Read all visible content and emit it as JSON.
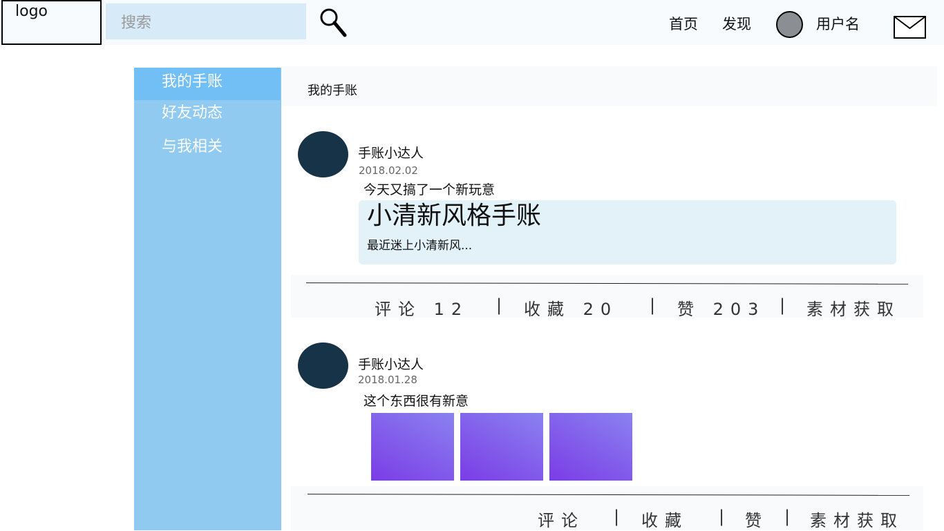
{
  "header": {
    "logo": "logo",
    "search_placeholder": "搜索",
    "nav": [
      "首页",
      "发现"
    ],
    "username": "用户名"
  },
  "sidebar": {
    "items": [
      {
        "label": "我的手账",
        "active": true
      },
      {
        "label": "好友动态",
        "active": false
      },
      {
        "label": "与我相关",
        "active": false
      }
    ]
  },
  "main": {
    "title": "我的手账",
    "posts": [
      {
        "author": "手账小达人",
        "date": "2018.02.02",
        "text": "今天又搞了一个新玩意",
        "article": {
          "title": "小清新风格手账",
          "summary": "最近迷上小清新风..."
        },
        "actions": {
          "comments": "评论 12",
          "favorites": "收藏 20",
          "likes": "赞 203",
          "materials": "素材获取"
        }
      },
      {
        "author": "手账小达人",
        "date": "2018.01.28",
        "text": "这个东西很有新意",
        "images": [
          "purple-gradient-image",
          "purple-gradient-image",
          "purple-gradient-image"
        ],
        "actions": {
          "comments": "评论",
          "favorites": "收藏",
          "likes": "赞",
          "materials": "素材获取"
        }
      }
    ]
  },
  "icons": {
    "search": "search-icon",
    "mail": "mail-icon",
    "avatar": "user-avatar"
  },
  "colors": {
    "sidebar": "#90caf0",
    "sidebar_active": "#71bff5",
    "avatar": "#173347",
    "image_gradient_start": "#7b3ce6",
    "image_gradient_end": "#8a82f0"
  }
}
